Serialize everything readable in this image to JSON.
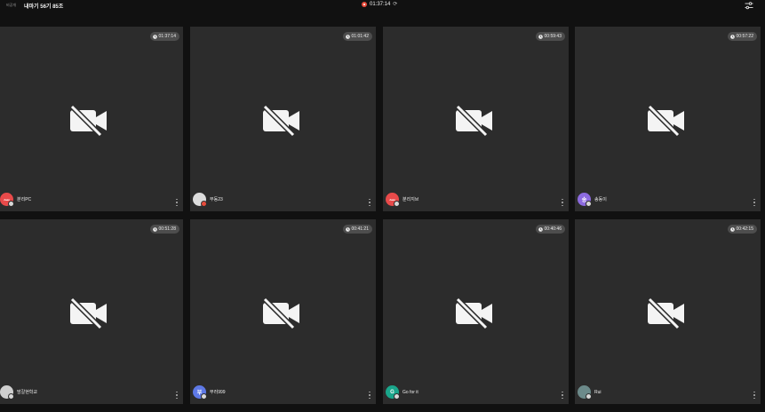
{
  "header": {
    "private_label": "비공개",
    "room_title": "내마기 56기 85조",
    "session_timer": "01:37:14",
    "refresh_icon": "refresh-icon",
    "settings_icon": "sliders-icon",
    "rec_color": "#e74c3c"
  },
  "tiles": [
    {
      "name": "분리PC",
      "timer": "01:37:14",
      "avatar_text": "Aaan",
      "avatar_color": "#e84a4a"
    },
    {
      "name": "부동23",
      "timer": "01:01:42",
      "avatar_text": "",
      "avatar_color": "#dcdcdc"
    },
    {
      "name": "분리지브",
      "timer": "00:59:43",
      "avatar_text": "Aaan",
      "avatar_color": "#e84a4a"
    },
    {
      "name": "송동이",
      "timer": "00:57:22",
      "avatar_text": "송",
      "avatar_color": "#8d6be0"
    },
    {
      "name": "맘갈현학교",
      "timer": "00:51:28",
      "avatar_text": "",
      "avatar_color": "#cfcfcf"
    },
    {
      "name": "부러999",
      "timer": "00:41:21",
      "avatar_text": "부",
      "avatar_color": "#5e79e6"
    },
    {
      "name": "Go for it",
      "timer": "00:40:46",
      "avatar_text": "G",
      "avatar_color": "#1aa68b"
    },
    {
      "name": "Rui",
      "timer": "00:42:15",
      "avatar_text": "",
      "avatar_color": "#6c8a8a"
    }
  ]
}
